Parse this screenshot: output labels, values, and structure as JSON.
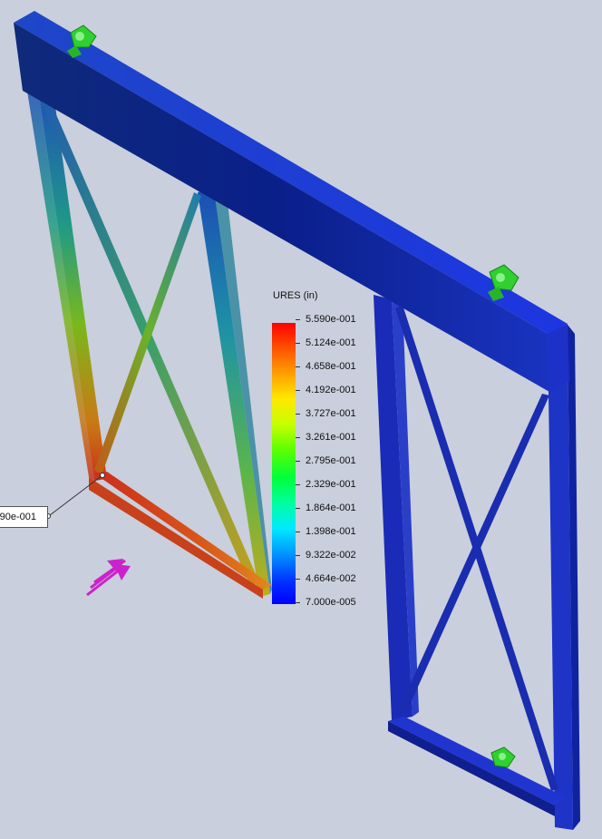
{
  "legend": {
    "title": "URES (in)",
    "labels": [
      "5.590e-001",
      "5.124e-001",
      "4.658e-001",
      "4.192e-001",
      "3.727e-001",
      "3.261e-001",
      "2.795e-001",
      "2.329e-001",
      "1.864e-001",
      "1.398e-001",
      "9.322e-002",
      "4.664e-002",
      "7.000e-005"
    ]
  },
  "probe": {
    "value": "90e-001"
  },
  "colors": {
    "background": "#c9cfdc",
    "frame_blue": "#1a2fc0",
    "fixture_green": "#2fd02f",
    "load_magenta": "#cc22cc"
  },
  "icons": [
    "fixture-icon",
    "external-load-arrow-icon"
  ]
}
